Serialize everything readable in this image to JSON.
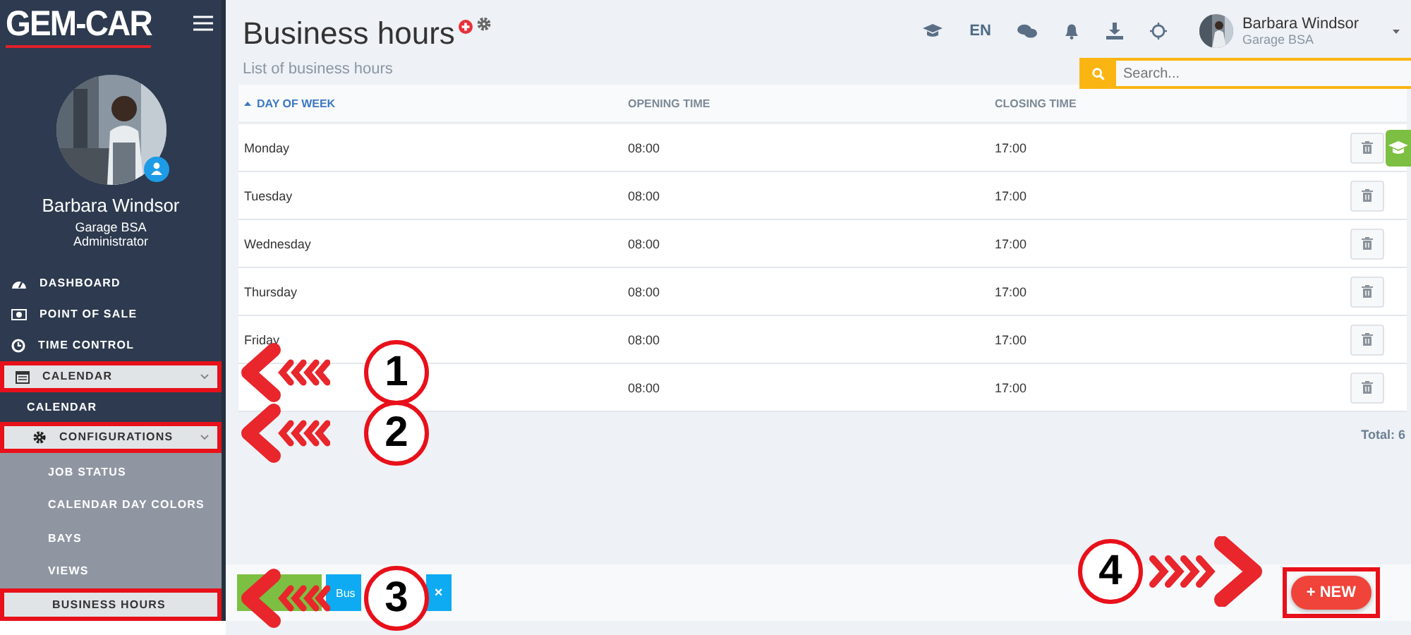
{
  "brand": {
    "logo": "GEM-CAR"
  },
  "user": {
    "name": "Barbara Windsor",
    "company": "Garage BSA",
    "role": "Administrator"
  },
  "sidebar": {
    "items": [
      {
        "label": "DASHBOARD",
        "active": false,
        "highlighted": false
      },
      {
        "label": "POINT OF SALE",
        "active": false,
        "highlighted": false
      },
      {
        "label": "TIME CONTROL",
        "active": false,
        "highlighted": false
      },
      {
        "label": "CALENDAR",
        "active": true,
        "highlighted": true,
        "expanded": true,
        "children": [
          {
            "label": "CALENDAR",
            "active": false,
            "highlighted": false
          },
          {
            "label": "CONFIGURATIONS",
            "active": true,
            "highlighted": true,
            "expanded": true,
            "children": [
              {
                "label": "JOB STATUS",
                "active": false,
                "highlighted": false
              },
              {
                "label": "CALENDAR DAY COLORS",
                "active": false,
                "highlighted": false
              },
              {
                "label": "BAYS",
                "active": false,
                "highlighted": false
              },
              {
                "label": "VIEWS",
                "active": false,
                "highlighted": false
              },
              {
                "label": "BUSINESS HOURS",
                "active": true,
                "highlighted": true
              }
            ]
          }
        ]
      }
    ]
  },
  "page": {
    "title": "Business hours",
    "subtitle": "List of business hours"
  },
  "topbar": {
    "language": "EN",
    "user_name": "Barbara Windsor",
    "user_company": "Garage BSA"
  },
  "search": {
    "placeholder": "Search..."
  },
  "table": {
    "columns": [
      {
        "label": "DAY OF WEEK",
        "sorted": true
      },
      {
        "label": "OPENING TIME",
        "sorted": false
      },
      {
        "label": "CLOSING TIME",
        "sorted": false
      }
    ],
    "rows": [
      {
        "day": "Monday",
        "opening": "08:00",
        "closing": "17:00"
      },
      {
        "day": "Tuesday",
        "opening": "08:00",
        "closing": "17:00"
      },
      {
        "day": "Wednesday",
        "opening": "08:00",
        "closing": "17:00"
      },
      {
        "day": "Thursday",
        "opening": "08:00",
        "closing": "17:00"
      },
      {
        "day": "Friday",
        "opening": "08:00",
        "closing": "17:00"
      },
      {
        "opening": "08:00",
        "closing": "17:00"
      }
    ]
  },
  "total": "Total: 6",
  "new_button": {
    "label": "+ NEW",
    "highlighted": true
  },
  "open_tabs": [
    {
      "kind": "blank"
    },
    {
      "kind": "labeled",
      "label": "Bus",
      "close": "×"
    }
  ],
  "annotations": [
    {
      "number": "1"
    },
    {
      "number": "2"
    },
    {
      "number": "3"
    },
    {
      "number": "4"
    }
  ]
}
